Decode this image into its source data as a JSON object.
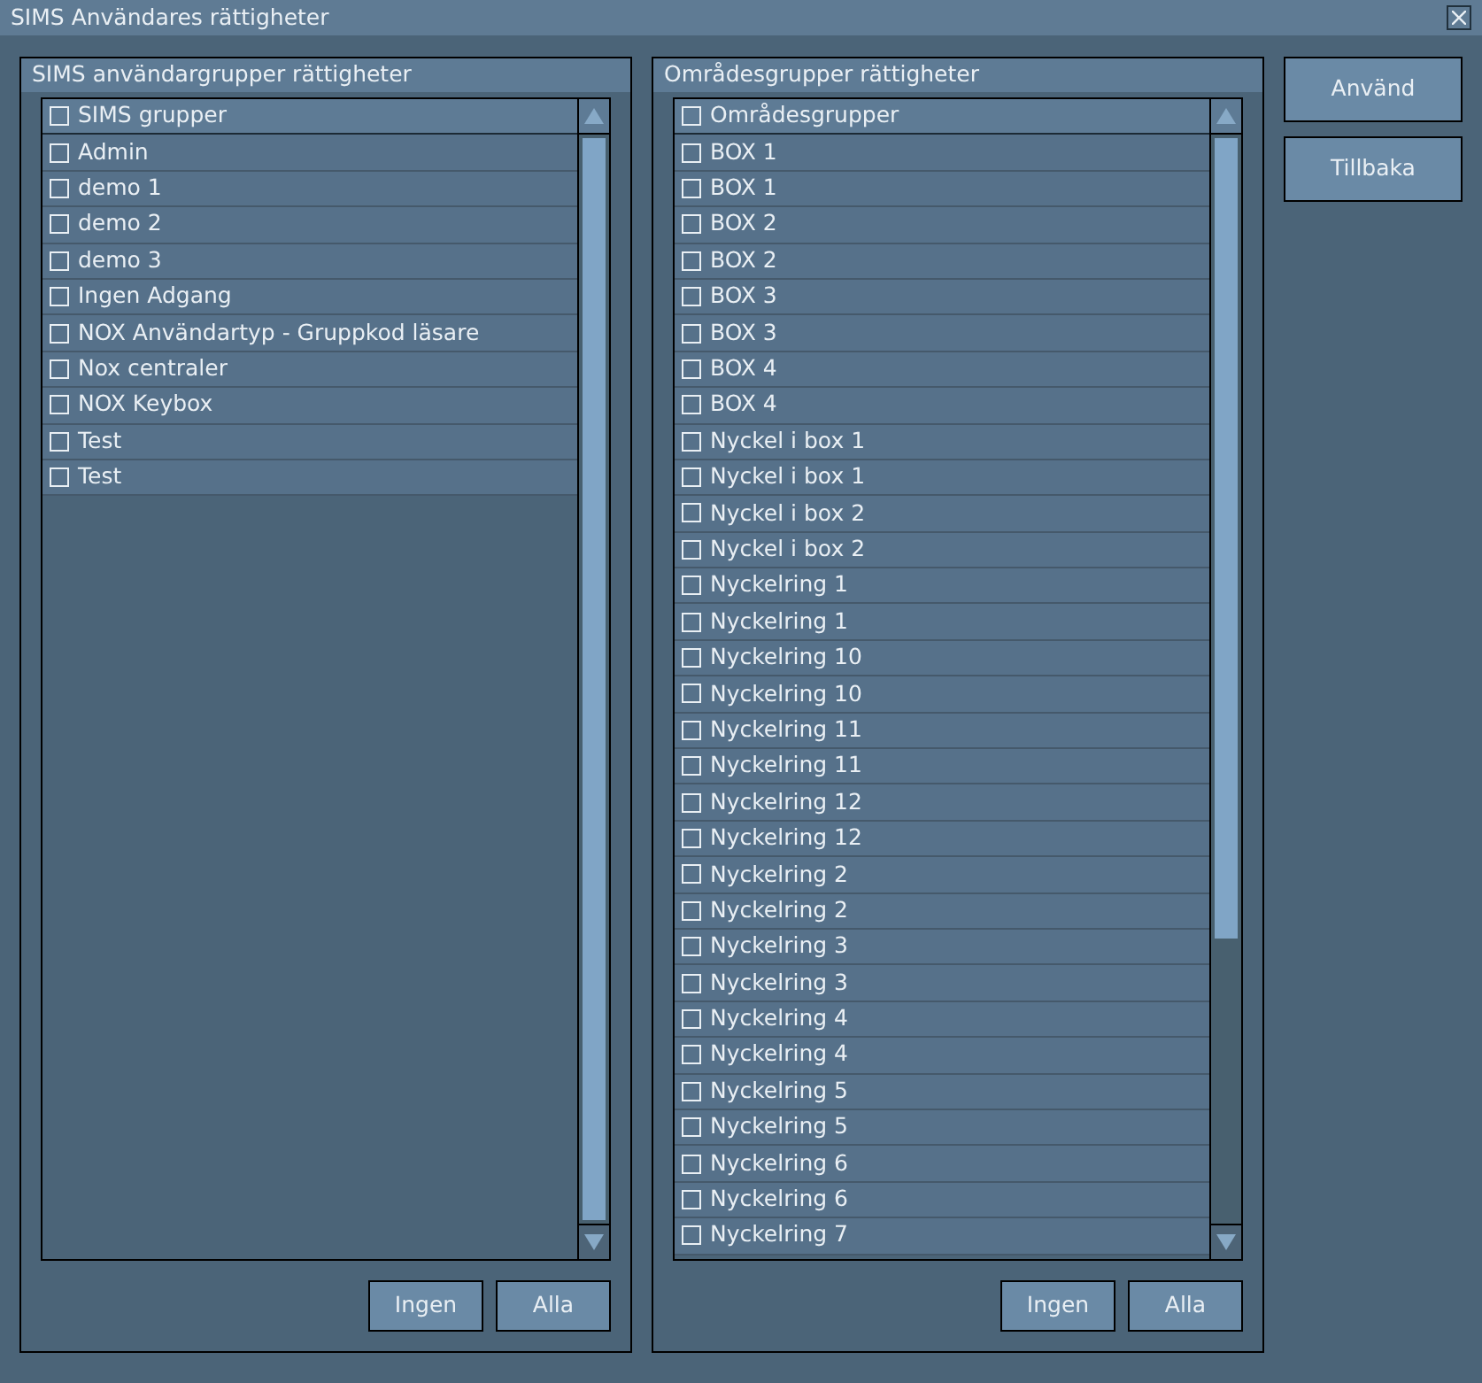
{
  "window": {
    "title": "SIMS Användares rättigheter"
  },
  "panels": [
    {
      "title": "SIMS användargrupper rättigheter",
      "header": {
        "label": "SIMS grupper",
        "checked": false
      },
      "items": [
        {
          "label": "Admin",
          "checked": false
        },
        {
          "label": "demo 1",
          "checked": false
        },
        {
          "label": "demo 2",
          "checked": false
        },
        {
          "label": "demo 3",
          "checked": false
        },
        {
          "label": "Ingen Adgang",
          "checked": false
        },
        {
          "label": "NOX Användartyp - Gruppkod läsare",
          "checked": false
        },
        {
          "label": "Nox centraler",
          "checked": false
        },
        {
          "label": "NOX Keybox",
          "checked": false
        },
        {
          "label": "Test",
          "checked": false
        },
        {
          "label": "Test",
          "checked": false
        }
      ],
      "buttons": [
        "Ingen",
        "Alla"
      ]
    },
    {
      "title": "Områdesgrupper rättigheter",
      "header": {
        "label": "Områdesgrupper",
        "checked": false
      },
      "items": [
        {
          "label": "BOX 1",
          "checked": false
        },
        {
          "label": "BOX 1",
          "checked": false
        },
        {
          "label": "BOX 2",
          "checked": false
        },
        {
          "label": "BOX 2",
          "checked": false
        },
        {
          "label": "BOX 3",
          "checked": false
        },
        {
          "label": "BOX 3",
          "checked": false
        },
        {
          "label": "BOX 4",
          "checked": false
        },
        {
          "label": "BOX 4",
          "checked": false
        },
        {
          "label": "Nyckel i box 1",
          "checked": false
        },
        {
          "label": "Nyckel i box 1",
          "checked": false
        },
        {
          "label": "Nyckel i box 2",
          "checked": false
        },
        {
          "label": "Nyckel i box 2",
          "checked": false
        },
        {
          "label": "Nyckelring 1",
          "checked": false
        },
        {
          "label": "Nyckelring 1",
          "checked": false
        },
        {
          "label": "Nyckelring 10",
          "checked": false
        },
        {
          "label": "Nyckelring 10",
          "checked": false
        },
        {
          "label": "Nyckelring 11",
          "checked": false
        },
        {
          "label": "Nyckelring 11",
          "checked": false
        },
        {
          "label": "Nyckelring 12",
          "checked": false
        },
        {
          "label": "Nyckelring 12",
          "checked": false
        },
        {
          "label": "Nyckelring 2",
          "checked": false
        },
        {
          "label": "Nyckelring 2",
          "checked": false
        },
        {
          "label": "Nyckelring 3",
          "checked": false
        },
        {
          "label": "Nyckelring 3",
          "checked": false
        },
        {
          "label": "Nyckelring 4",
          "checked": false
        },
        {
          "label": "Nyckelring 4",
          "checked": false
        },
        {
          "label": "Nyckelring 5",
          "checked": false
        },
        {
          "label": "Nyckelring 5",
          "checked": false
        },
        {
          "label": "Nyckelring 6",
          "checked": false
        },
        {
          "label": "Nyckelring 6",
          "checked": false
        },
        {
          "label": "Nyckelring 7",
          "checked": false
        }
      ],
      "buttons": [
        "Ingen",
        "Alla"
      ]
    }
  ],
  "actions": [
    "Använd",
    "Tillbaka"
  ]
}
